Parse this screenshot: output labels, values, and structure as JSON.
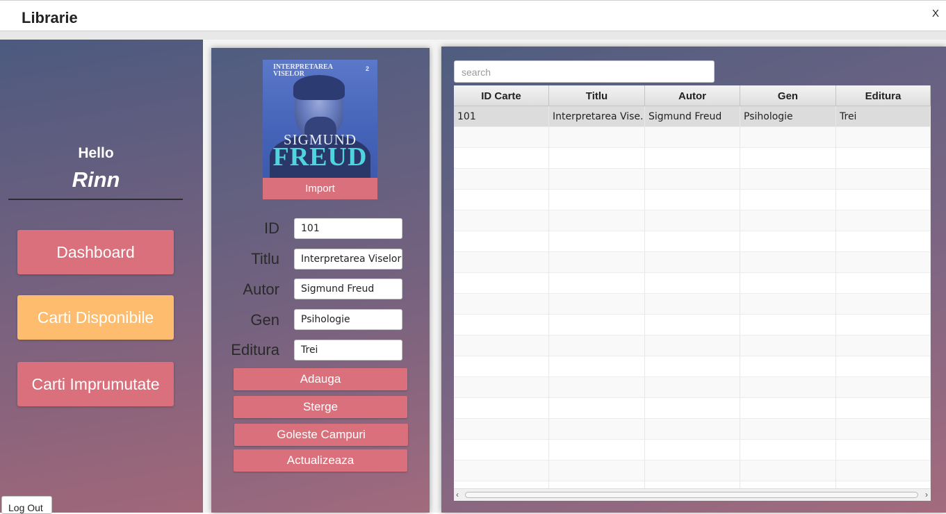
{
  "window": {
    "title": "Librarie",
    "close_label": "X"
  },
  "sidebar": {
    "greeting": "Hello",
    "username": "Rinn",
    "nav": [
      {
        "label": "Dashboard",
        "color": "#d9707b"
      },
      {
        "label": "Carti Disponibile",
        "color": "#fdbc6e"
      },
      {
        "label": "Carti Imprumutate",
        "color": "#d9707b"
      }
    ],
    "logout_label": "Log Out"
  },
  "form": {
    "cover": {
      "top_text_1": "INTERPRETAREA",
      "top_text_2": "VISELOR",
      "side_text": "2",
      "author_first": "SIGMUND",
      "author_last": "FREUD"
    },
    "import_label": "Import",
    "fields": [
      {
        "label": "ID",
        "value": "101"
      },
      {
        "label": "Titlu",
        "value": "Interpretarea Viselor"
      },
      {
        "label": "Autor",
        "value": "Sigmund Freud"
      },
      {
        "label": "Gen",
        "value": "Psihologie"
      },
      {
        "label": "Editura",
        "value": "Trei"
      }
    ],
    "buttons": {
      "add": "Adauga",
      "delete": "Sterge",
      "clear": "Goleste Campuri",
      "update": "Actualizeaza"
    }
  },
  "table": {
    "search_placeholder": "search",
    "columns": [
      "ID Carte",
      "Titlu",
      "Autor",
      "Gen",
      "Editura"
    ],
    "rows": [
      [
        "101",
        "Interpretarea Vise...",
        "Sigmund Freud",
        "Psihologie",
        "Trei"
      ]
    ]
  },
  "colors": {
    "accent": "#d9707b",
    "highlight": "#fdbc6e"
  }
}
